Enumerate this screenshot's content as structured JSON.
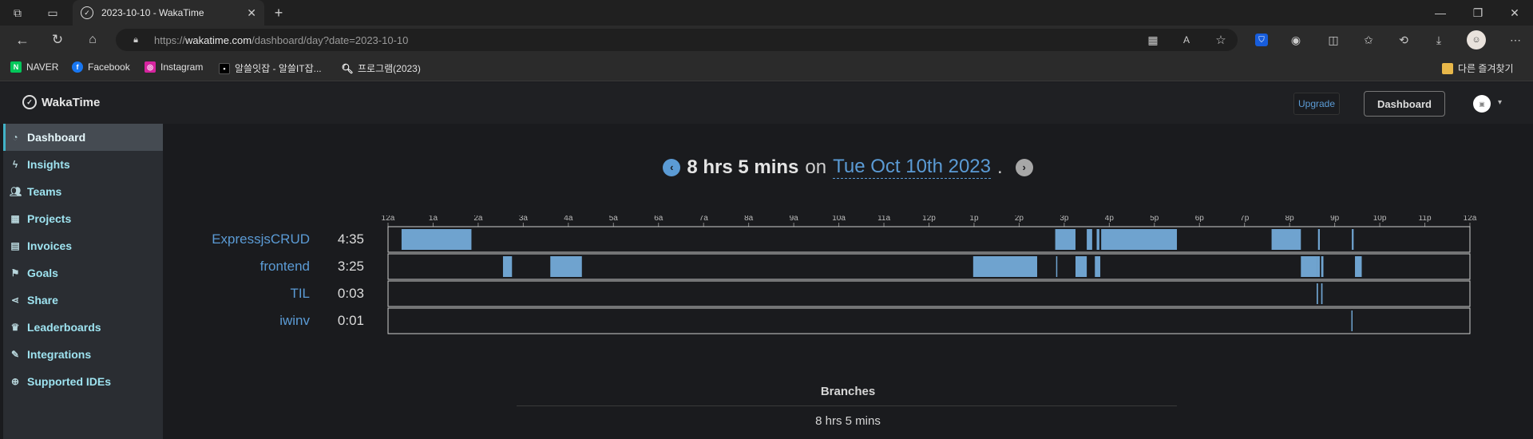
{
  "browser": {
    "tab_title": "2023-10-10 - WakaTime",
    "url_prefix": "https://",
    "url_host": "wakatime.com",
    "url_path": "/dashboard/day?date=2023-10-10",
    "bookmarks": [
      "NAVER",
      "Facebook",
      "Instagram",
      "알쓸잇잡 - 알쓸IT잡...",
      "프로그램(2023)"
    ],
    "other_bookmarks": "다른 즐겨찾기"
  },
  "app": {
    "logo": "WakaTime",
    "upgrade_label": "Upgrade",
    "dashboard_label": "Dashboard"
  },
  "sidebar": {
    "items": [
      {
        "label": "Dashboard",
        "icon": "dashboard-icon"
      },
      {
        "label": "Insights",
        "icon": "bolt-icon"
      },
      {
        "label": "Teams",
        "icon": "users-icon"
      },
      {
        "label": "Projects",
        "icon": "grid-icon"
      },
      {
        "label": "Invoices",
        "icon": "file-icon"
      },
      {
        "label": "Goals",
        "icon": "flag-icon"
      },
      {
        "label": "Share",
        "icon": "share-icon"
      },
      {
        "label": "Leaderboards",
        "icon": "trophy-icon"
      },
      {
        "label": "Integrations",
        "icon": "wrench-icon"
      },
      {
        "label": "Supported IDEs",
        "icon": "plus-circle-icon"
      }
    ]
  },
  "day": {
    "total": "8 hrs 5 mins",
    "on": "on",
    "date": "Tue Oct 10th 2023",
    "period": "."
  },
  "colors": {
    "accent": "#5b9bd5",
    "bar": "#6fa3cf",
    "sidebar_active": "#41b3c8"
  },
  "chart_data": {
    "type": "timeline",
    "hour_ticks": [
      "12a",
      "1a",
      "2a",
      "3a",
      "4a",
      "5a",
      "6a",
      "7a",
      "8a",
      "9a",
      "10a",
      "11a",
      "12p",
      "1p",
      "2p",
      "3p",
      "4p",
      "5p",
      "6p",
      "7p",
      "8p",
      "9p",
      "10p",
      "11p",
      "12a"
    ],
    "x_unit": "hours since midnight",
    "xlim": [
      0,
      24
    ],
    "series": [
      {
        "name": "ExpressjsCRUD",
        "duration": "4:35",
        "segments": [
          [
            0.3,
            1.85
          ],
          [
            14.8,
            15.25
          ],
          [
            15.5,
            15.62
          ],
          [
            15.72,
            15.78
          ],
          [
            15.82,
            17.5
          ],
          [
            19.6,
            20.25
          ],
          [
            20.63,
            20.67
          ],
          [
            21.38,
            21.42
          ]
        ]
      },
      {
        "name": "frontend",
        "duration": "3:25",
        "segments": [
          [
            2.55,
            2.75
          ],
          [
            3.6,
            4.3
          ],
          [
            12.98,
            14.4
          ],
          [
            14.82,
            14.83
          ],
          [
            15.25,
            15.5
          ],
          [
            15.68,
            15.8
          ],
          [
            20.25,
            20.6
          ],
          [
            20.6,
            20.67
          ],
          [
            20.7,
            20.75
          ],
          [
            21.45,
            21.6
          ]
        ]
      },
      {
        "name": "TIL",
        "duration": "0:03",
        "segments": [
          [
            20.6,
            20.63
          ],
          [
            20.7,
            20.73
          ]
        ]
      },
      {
        "name": "iwinv",
        "duration": "0:01",
        "segments": [
          [
            21.37,
            21.39
          ]
        ]
      }
    ]
  },
  "branches": {
    "title": "Branches",
    "total": "8 hrs 5 mins"
  }
}
